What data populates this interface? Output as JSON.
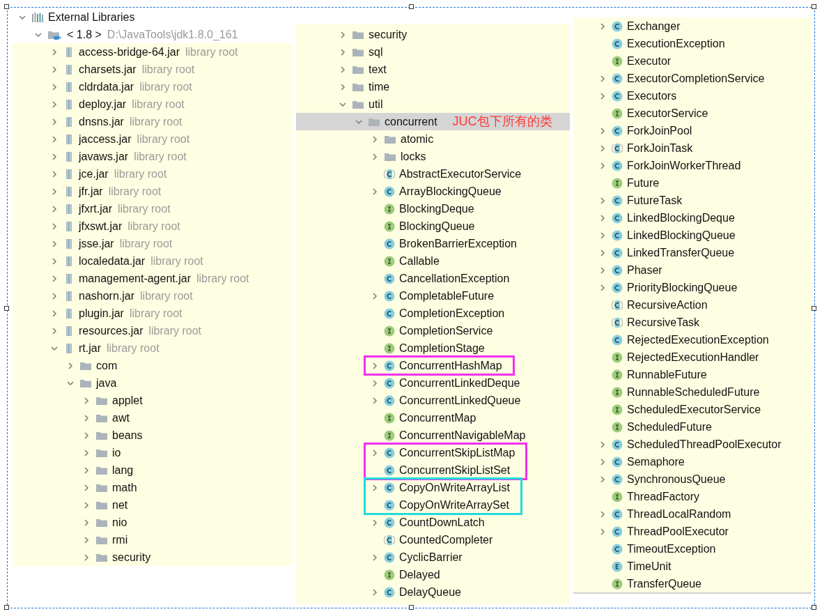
{
  "panels": [
    {
      "nodes": [
        {
          "label": "External Libraries",
          "kind": "library",
          "selected": false,
          "expanded": true,
          "children": [
            {
              "label": "< 1.8 >",
              "kind": "jdk",
              "selected": false,
              "expanded": true,
              "hint": "D:\\JavaTools\\jdk1.8.0_161",
              "children": [
                {
                  "label": "access-bridge-64.jar",
                  "kind": "jar",
                  "selected": false,
                  "expanded": false,
                  "hint": "library root"
                },
                {
                  "label": "charsets.jar",
                  "kind": "jar",
                  "selected": false,
                  "expanded": false,
                  "hint": "library root"
                },
                {
                  "label": "cldrdata.jar",
                  "kind": "jar",
                  "selected": false,
                  "expanded": false,
                  "hint": "library root"
                },
                {
                  "label": "deploy.jar",
                  "kind": "jar",
                  "selected": false,
                  "expanded": false,
                  "hint": "library root"
                },
                {
                  "label": "dnsns.jar",
                  "kind": "jar",
                  "selected": false,
                  "expanded": false,
                  "hint": "library root"
                },
                {
                  "label": "jaccess.jar",
                  "kind": "jar",
                  "selected": false,
                  "expanded": false,
                  "hint": "library root"
                },
                {
                  "label": "javaws.jar",
                  "kind": "jar",
                  "selected": false,
                  "expanded": false,
                  "hint": "library root"
                },
                {
                  "label": "jce.jar",
                  "kind": "jar",
                  "selected": false,
                  "expanded": false,
                  "hint": "library root"
                },
                {
                  "label": "jfr.jar",
                  "kind": "jar",
                  "selected": false,
                  "expanded": false,
                  "hint": "library root"
                },
                {
                  "label": "jfxrt.jar",
                  "kind": "jar",
                  "selected": false,
                  "expanded": false,
                  "hint": "library root"
                },
                {
                  "label": "jfxswt.jar",
                  "kind": "jar",
                  "selected": false,
                  "expanded": false,
                  "hint": "library root"
                },
                {
                  "label": "jsse.jar",
                  "kind": "jar",
                  "selected": false,
                  "expanded": false,
                  "hint": "library root"
                },
                {
                  "label": "localedata.jar",
                  "kind": "jar",
                  "selected": false,
                  "expanded": false,
                  "hint": "library root"
                },
                {
                  "label": "management-agent.jar",
                  "kind": "jar",
                  "selected": false,
                  "expanded": false,
                  "hint": "library root"
                },
                {
                  "label": "nashorn.jar",
                  "kind": "jar",
                  "selected": false,
                  "expanded": false,
                  "hint": "library root"
                },
                {
                  "label": "plugin.jar",
                  "kind": "jar",
                  "selected": false,
                  "expanded": false,
                  "hint": "library root"
                },
                {
                  "label": "resources.jar",
                  "kind": "jar",
                  "selected": false,
                  "expanded": false,
                  "hint": "library root"
                },
                {
                  "label": "rt.jar",
                  "kind": "jar",
                  "selected": false,
                  "expanded": true,
                  "hint": "library root",
                  "children": [
                    {
                      "label": "com",
                      "kind": "folder",
                      "selected": false,
                      "expanded": false
                    },
                    {
                      "label": "java",
                      "kind": "folder",
                      "selected": false,
                      "expanded": true,
                      "children": [
                        {
                          "label": "applet",
                          "kind": "folder",
                          "selected": false,
                          "expanded": false
                        },
                        {
                          "label": "awt",
                          "kind": "folder",
                          "selected": false,
                          "expanded": false
                        },
                        {
                          "label": "beans",
                          "kind": "folder",
                          "selected": false,
                          "expanded": false
                        },
                        {
                          "label": "io",
                          "kind": "folder",
                          "selected": false,
                          "expanded": false
                        },
                        {
                          "label": "lang",
                          "kind": "folder",
                          "selected": false,
                          "expanded": false
                        },
                        {
                          "label": "math",
                          "kind": "folder",
                          "selected": false,
                          "expanded": false
                        },
                        {
                          "label": "net",
                          "kind": "folder",
                          "selected": false,
                          "expanded": false
                        },
                        {
                          "label": "nio",
                          "kind": "folder",
                          "selected": false,
                          "expanded": false
                        },
                        {
                          "label": "rmi",
                          "kind": "folder",
                          "selected": false,
                          "expanded": false
                        },
                        {
                          "label": "security",
                          "kind": "folder",
                          "selected": false,
                          "expanded": false
                        }
                      ]
                    }
                  ]
                }
              ]
            }
          ]
        }
      ]
    },
    {
      "nodes": [
        {
          "label": "security",
          "kind": "folder",
          "selected": false,
          "expanded": false
        },
        {
          "label": "sql",
          "kind": "folder",
          "selected": false,
          "expanded": false
        },
        {
          "label": "text",
          "kind": "folder",
          "selected": false,
          "expanded": false
        },
        {
          "label": "time",
          "kind": "folder",
          "selected": false,
          "expanded": false
        },
        {
          "label": "util",
          "kind": "folder",
          "selected": false,
          "expanded": true,
          "children": [
            {
              "label": "concurrent",
              "kind": "folder",
              "selected": true,
              "expanded": true,
              "note": "JUC包下所有的类",
              "children": [
                {
                  "label": "atomic",
                  "kind": "folder",
                  "selected": false,
                  "expanded": false
                },
                {
                  "label": "locks",
                  "kind": "folder",
                  "selected": false,
                  "expanded": false
                },
                {
                  "label": "AbstractExecutorService",
                  "kind": "abstract",
                  "selected": false
                },
                {
                  "label": "ArrayBlockingQueue",
                  "kind": "class",
                  "selected": false,
                  "expanded": false
                },
                {
                  "label": "BlockingDeque",
                  "kind": "interface",
                  "selected": false
                },
                {
                  "label": "BlockingQueue",
                  "kind": "interface",
                  "selected": false
                },
                {
                  "label": "BrokenBarrierException",
                  "kind": "class",
                  "selected": false
                },
                {
                  "label": "Callable",
                  "kind": "interface",
                  "selected": false
                },
                {
                  "label": "CancellationException",
                  "kind": "class",
                  "selected": false
                },
                {
                  "label": "CompletableFuture",
                  "kind": "class",
                  "selected": false,
                  "expanded": false
                },
                {
                  "label": "CompletionException",
                  "kind": "class",
                  "selected": false
                },
                {
                  "label": "CompletionService",
                  "kind": "interface",
                  "selected": false
                },
                {
                  "label": "CompletionStage",
                  "kind": "interface",
                  "selected": false
                },
                {
                  "label": "ConcurrentHashMap",
                  "kind": "class",
                  "selected": false,
                  "expanded": false,
                  "color": "#f030f0"
                },
                {
                  "label": "ConcurrentLinkedDeque",
                  "kind": "class",
                  "selected": false,
                  "expanded": false
                },
                {
                  "label": "ConcurrentLinkedQueue",
                  "kind": "class",
                  "selected": false,
                  "expanded": false
                },
                {
                  "label": "ConcurrentMap",
                  "kind": "interface",
                  "selected": false
                },
                {
                  "label": "ConcurrentNavigableMap",
                  "kind": "interface",
                  "selected": false
                },
                {
                  "label": "ConcurrentSkipListMap",
                  "kind": "class",
                  "selected": false,
                  "expanded": false,
                  "color": "#f030f0"
                },
                {
                  "label": "ConcurrentSkipListSet",
                  "kind": "class",
                  "selected": false,
                  "color": "#f030f0"
                },
                {
                  "label": "CopyOnWriteArrayList",
                  "kind": "class",
                  "selected": false,
                  "expanded": false,
                  "color": "#20dcdc"
                },
                {
                  "label": "CopyOnWriteArraySet",
                  "kind": "class",
                  "selected": false,
                  "color": "#20dcdc"
                },
                {
                  "label": "CountDownLatch",
                  "kind": "class",
                  "selected": false,
                  "expanded": false
                },
                {
                  "label": "CountedCompleter",
                  "kind": "abstract",
                  "selected": false
                },
                {
                  "label": "CyclicBarrier",
                  "kind": "class",
                  "selected": false,
                  "expanded": false
                },
                {
                  "label": "Delayed",
                  "kind": "interface",
                  "selected": false
                },
                {
                  "label": "DelayQueue",
                  "kind": "class",
                  "selected": false,
                  "expanded": false
                }
              ]
            }
          ]
        }
      ]
    },
    {
      "nodes": [
        {
          "label": "Exchanger",
          "kind": "class",
          "selected": false,
          "expanded": false
        },
        {
          "label": "ExecutionException",
          "kind": "class",
          "selected": false
        },
        {
          "label": "Executor",
          "kind": "interface",
          "selected": false
        },
        {
          "label": "ExecutorCompletionService",
          "kind": "class",
          "selected": false,
          "expanded": false
        },
        {
          "label": "Executors",
          "kind": "class",
          "selected": false,
          "expanded": false
        },
        {
          "label": "ExecutorService",
          "kind": "interface",
          "selected": false
        },
        {
          "label": "ForkJoinPool",
          "kind": "class",
          "selected": false,
          "expanded": false
        },
        {
          "label": "ForkJoinTask",
          "kind": "abstract",
          "selected": false,
          "expanded": false
        },
        {
          "label": "ForkJoinWorkerThread",
          "kind": "class",
          "selected": false,
          "expanded": false
        },
        {
          "label": "Future",
          "kind": "interface",
          "selected": false
        },
        {
          "label": "FutureTask",
          "kind": "class",
          "selected": false,
          "expanded": false
        },
        {
          "label": "LinkedBlockingDeque",
          "kind": "class",
          "selected": false,
          "expanded": false
        },
        {
          "label": "LinkedBlockingQueue",
          "kind": "class",
          "selected": false,
          "expanded": false
        },
        {
          "label": "LinkedTransferQueue",
          "kind": "class",
          "selected": false,
          "expanded": false
        },
        {
          "label": "Phaser",
          "kind": "class",
          "selected": false,
          "expanded": false
        },
        {
          "label": "PriorityBlockingQueue",
          "kind": "class",
          "selected": false,
          "expanded": false
        },
        {
          "label": "RecursiveAction",
          "kind": "abstract",
          "selected": false
        },
        {
          "label": "RecursiveTask",
          "kind": "abstract",
          "selected": false
        },
        {
          "label": "RejectedExecutionException",
          "kind": "class",
          "selected": false
        },
        {
          "label": "RejectedExecutionHandler",
          "kind": "interface",
          "selected": false
        },
        {
          "label": "RunnableFuture",
          "kind": "interface",
          "selected": false
        },
        {
          "label": "RunnableScheduledFuture",
          "kind": "interface",
          "selected": false
        },
        {
          "label": "ScheduledExecutorService",
          "kind": "interface",
          "selected": false
        },
        {
          "label": "ScheduledFuture",
          "kind": "interface",
          "selected": false
        },
        {
          "label": "ScheduledThreadPoolExecutor",
          "kind": "class",
          "selected": false,
          "expanded": false
        },
        {
          "label": "Semaphore",
          "kind": "class",
          "selected": false,
          "expanded": false
        },
        {
          "label": "SynchronousQueue",
          "kind": "class",
          "selected": false,
          "expanded": false
        },
        {
          "label": "ThreadFactory",
          "kind": "interface",
          "selected": false
        },
        {
          "label": "ThreadLocalRandom",
          "kind": "class",
          "selected": false,
          "expanded": false
        },
        {
          "label": "ThreadPoolExecutor",
          "kind": "class",
          "selected": false,
          "expanded": false
        },
        {
          "label": "TimeoutException",
          "kind": "class",
          "selected": false
        },
        {
          "label": "TimeUnit",
          "kind": "enum",
          "selected": false
        },
        {
          "label": "TransferQueue",
          "kind": "interface",
          "selected": false
        }
      ]
    }
  ]
}
